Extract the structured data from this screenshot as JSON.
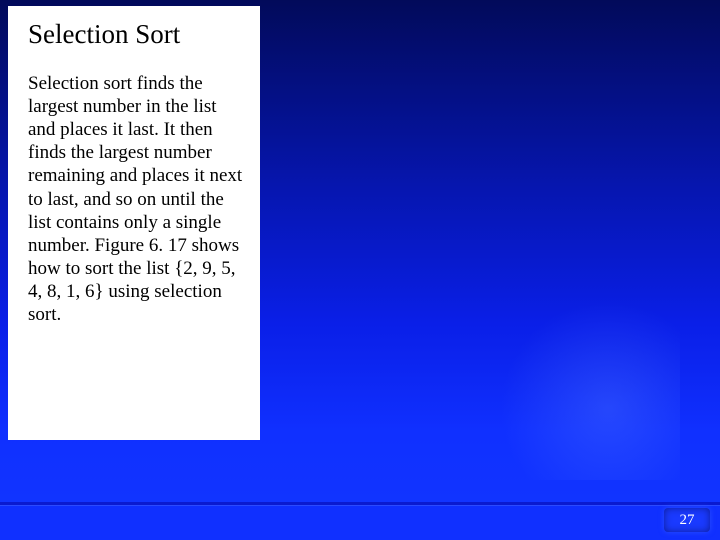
{
  "slide": {
    "title": "Selection Sort",
    "body": "Selection sort finds the largest number in the list and places it last. It then finds the largest number remaining and places it next to last, and so on until the list contains only a single number. Figure 6. 17 shows how to sort the list {2, 9, 5, 4, 8, 1, 6} using selection sort.",
    "page_number": "27"
  }
}
